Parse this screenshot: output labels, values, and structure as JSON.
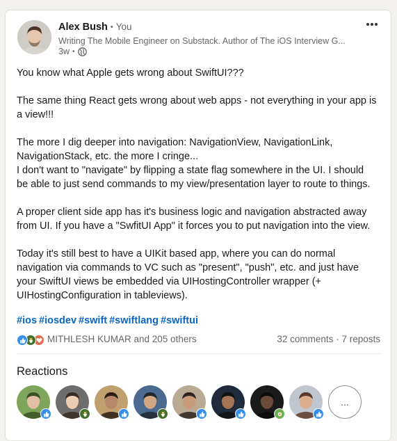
{
  "post": {
    "author": {
      "name": "Alex Bush",
      "relation": "You",
      "headline": "Writing The Mobile Engineer on Substack. Author of The iOS Interview G...",
      "time": "3w",
      "avatar_icon": "avatar-photo-alex-bush"
    },
    "body_paragraphs": [
      [
        "You know what Apple gets wrong about SwiftUI???"
      ],
      [
        "The same thing React gets wrong about web apps - not everything in your app is",
        "a view!!!"
      ],
      [
        "The more I dig deeper into navigation: NavigationView, NavigationLink,",
        "NavigationStack, etc. the more I cringe...",
        "I don't want to \"navigate\" by flipping a state flag somewhere in the UI. I should",
        "be able to just send commands to my view/presentation layer to route to things."
      ],
      [
        "A proper client side app has it's business logic and navigation abstracted away",
        "from UI. If you have a \"SwfitUI App\" it forces you to put navigation into the view."
      ],
      [
        "Today it's still best to have a UIKit based app, where you can do normal",
        "navigation via commands to VC such as \"present\", \"push\", etc. and just have",
        "your SwiftUI views be embedded via UIHostingController wrapper (+",
        "UIHostingConfiguration in tableviews)."
      ]
    ],
    "hashtags": [
      "#ios",
      "#iosdev",
      "#swift",
      "#swiftlang",
      "#swiftui"
    ]
  },
  "social": {
    "likers": "MITHLESH KUMAR and 205 others",
    "comments": "32 comments",
    "separator": "·",
    "reposts": "7 reposts",
    "reaction_types": [
      "like",
      "celebrate",
      "love"
    ]
  },
  "reactions": {
    "title": "Reactions",
    "more_label": "...",
    "people": [
      {
        "badge": "like"
      },
      {
        "badge": "celebrate"
      },
      {
        "badge": "like"
      },
      {
        "badge": "celebrate"
      },
      {
        "badge": "like"
      },
      {
        "badge": "like"
      },
      {
        "badge": "support"
      },
      {
        "badge": "like"
      }
    ]
  },
  "colors": {
    "link": "#0a66c2",
    "like": "#378fe9",
    "celebrate": "#44712e",
    "love": "#df704d",
    "support": "#6dae4f",
    "text_secondary": "#666666"
  }
}
